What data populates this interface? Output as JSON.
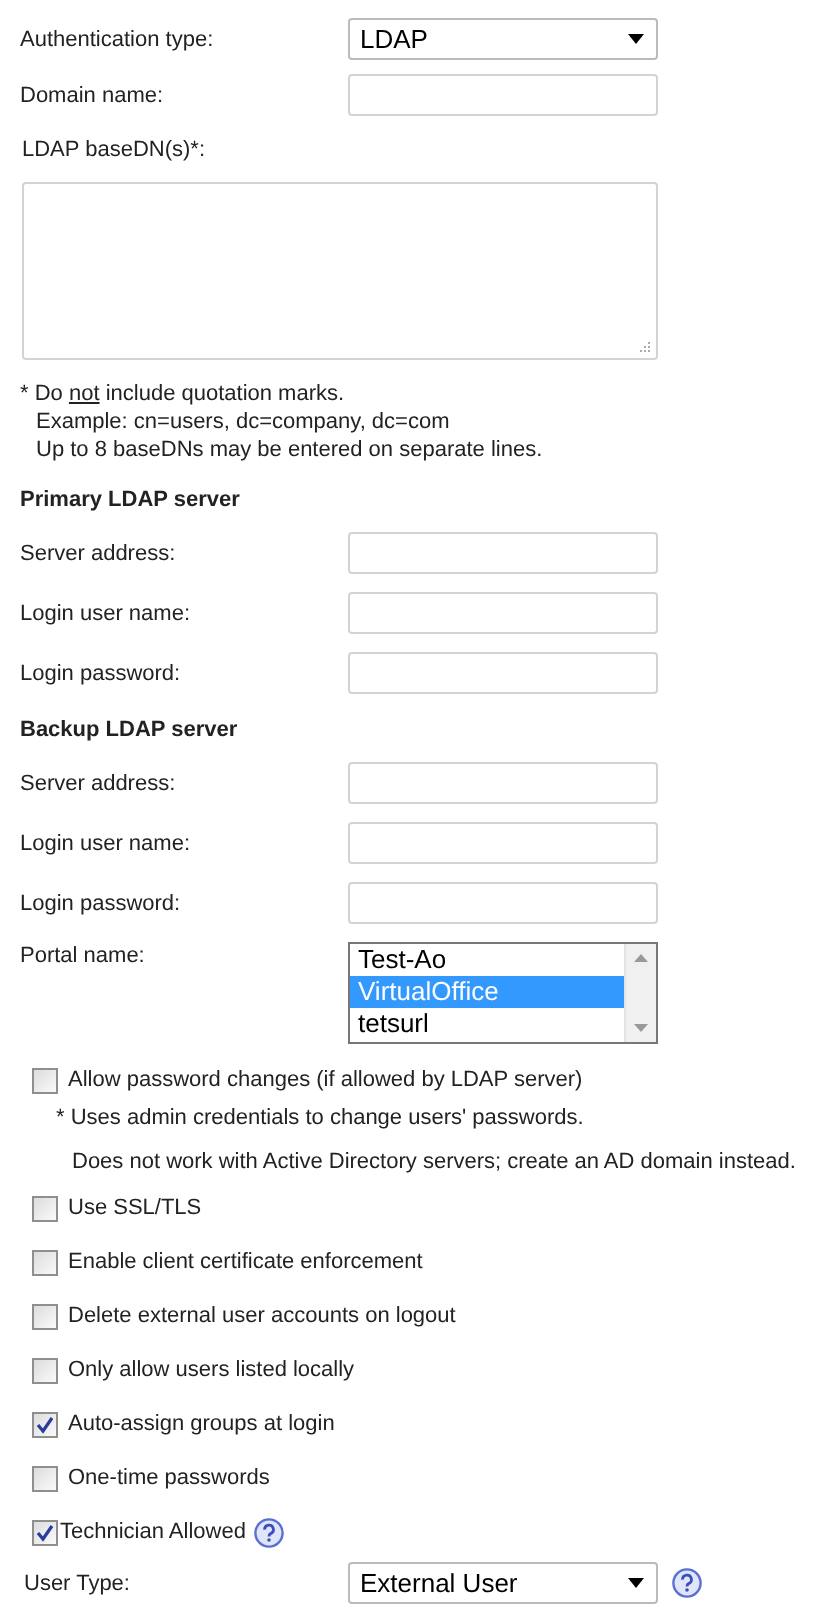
{
  "auth_type": {
    "label": "Authentication type:",
    "value": "LDAP"
  },
  "domain_name": {
    "label": "Domain name:"
  },
  "basedn": {
    "label": "LDAP baseDN(s)*:"
  },
  "basedn_note": {
    "before": "* Do",
    "underlined": "not",
    "after": "include quotation marks."
  },
  "basedn_hints": [
    "Example: cn=users, dc=company, dc=com",
    "Up to 8 baseDNs may be entered on separate lines."
  ],
  "sections": [
    {
      "heading": "Primary LDAP server",
      "fields": [
        {
          "label": "Server address:"
        },
        {
          "label": "Login user name:"
        },
        {
          "label": "Login password:"
        }
      ]
    },
    {
      "heading": "Backup LDAP server",
      "fields": [
        {
          "label": "Server address:"
        },
        {
          "label": "Login user name:"
        },
        {
          "label": "Login password:"
        }
      ]
    }
  ],
  "portal": {
    "label": "Portal name:",
    "options": [
      {
        "label": "Test-Ao",
        "selected": false
      },
      {
        "label": "VirtualOffice",
        "selected": true
      },
      {
        "label": "tetsurl",
        "selected": false
      }
    ]
  },
  "options": [
    {
      "label": "Allow password changes (if allowed by LDAP server)",
      "checked": false,
      "help": false,
      "notes": [
        "* Uses admin credentials to change users' passwords.",
        "Does not work with Active Directory servers; create an AD domain instead."
      ]
    },
    {
      "label": "Use SSL/TLS",
      "checked": false,
      "help": false
    },
    {
      "label": "Enable client certificate enforcement",
      "checked": false,
      "help": false
    },
    {
      "label": "Delete external user accounts on logout",
      "checked": false,
      "help": false
    },
    {
      "label": "Only allow users listed locally",
      "checked": false,
      "help": false
    },
    {
      "label": "Auto-assign groups at login",
      "checked": true,
      "help": false
    },
    {
      "label": "One-time passwords",
      "checked": false,
      "help": false
    },
    {
      "label": "Technician Allowed",
      "checked": true,
      "help": true
    }
  ],
  "user_type": {
    "label": "User Type:",
    "value": "External User",
    "help": true
  }
}
